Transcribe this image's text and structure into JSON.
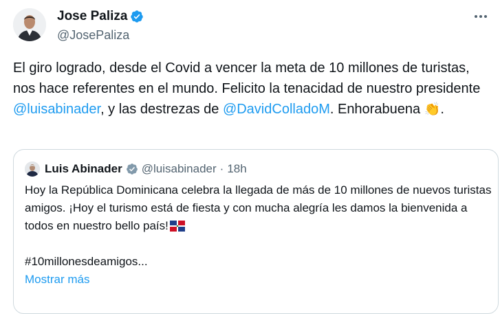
{
  "tweet": {
    "author_name": "Jose Paliza",
    "author_handle": "@JosePaliza",
    "text_part1": "El giro logrado, desde el Covid a vencer la meta de 10 millones de turistas, nos hace referentes en el mundo. Felicito la tenacidad de nuestro presidente ",
    "mention1": "@luisabinader",
    "text_part2": ", y las destrezas de ",
    "mention2": "@DavidColladoM",
    "text_part3": ". Enhorabuena ",
    "emoji": "👏",
    "text_end": "."
  },
  "quote": {
    "author_name": "Luis Abinader",
    "author_handle": "@luisabinader",
    "separator": "·",
    "time": "18h",
    "line1": "Hoy la República Dominicana celebra la llegada de más de 10 millones de nuevos turistas amigos. ¡Hoy el turismo está de fiesta y con mucha alegría les damos la bienvenida a todos en nuestro bello país!",
    "hashtag_line": "#10millonesdeamigos...",
    "show_more": "Mostrar más"
  },
  "colors": {
    "link": "#1d9bf0",
    "secondary": "#536471",
    "verified": "#1d9bf0",
    "border": "#cfd9de"
  },
  "icons": {
    "verified": "verified-badge-icon",
    "more": "more-options-icon",
    "flag": "dominican-republic-flag-icon"
  }
}
